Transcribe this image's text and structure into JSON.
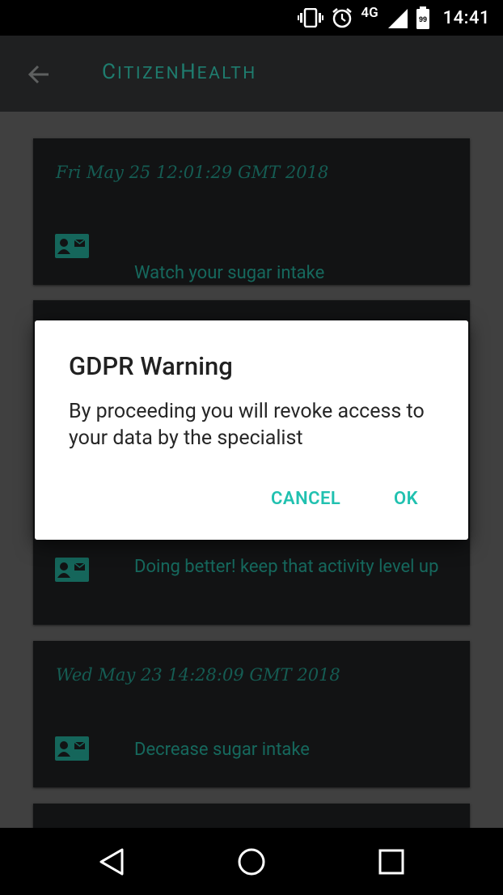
{
  "status_bar": {
    "time": "14:41",
    "network": "4G",
    "battery": "99",
    "icons": [
      "vibrate-icon",
      "alarm-icon",
      "signal-icon",
      "battery-icon"
    ]
  },
  "app_bar": {
    "title_parts": [
      "C",
      "ITIZEN",
      "H",
      "EALTH"
    ],
    "back_icon": "arrow-back-icon"
  },
  "cards": [
    {
      "date": "Fri May 25 12:01:29 GMT 2018",
      "message": "Watch your sugar intake",
      "icon": "contact-mail-icon"
    },
    {
      "date": "",
      "message": "Doing better! keep that activity level up",
      "icon": "contact-mail-icon"
    },
    {
      "date": "Wed May 23 14:28:09 GMT 2018",
      "message": "Decrease sugar intake",
      "icon": "contact-mail-icon"
    }
  ],
  "dialog": {
    "title": "GDPR Warning",
    "body": "By proceeding you will revoke access to your data by the specialist",
    "cancel_label": "CANCEL",
    "ok_label": "OK"
  },
  "nav_bar": {
    "icons": [
      "back-triangle-icon",
      "home-circle-icon",
      "recents-square-icon"
    ]
  },
  "colors": {
    "accent": "#21c1b0",
    "app_title": "#1f7c6e",
    "card_text": "#16685d",
    "scrim": "#404040"
  }
}
